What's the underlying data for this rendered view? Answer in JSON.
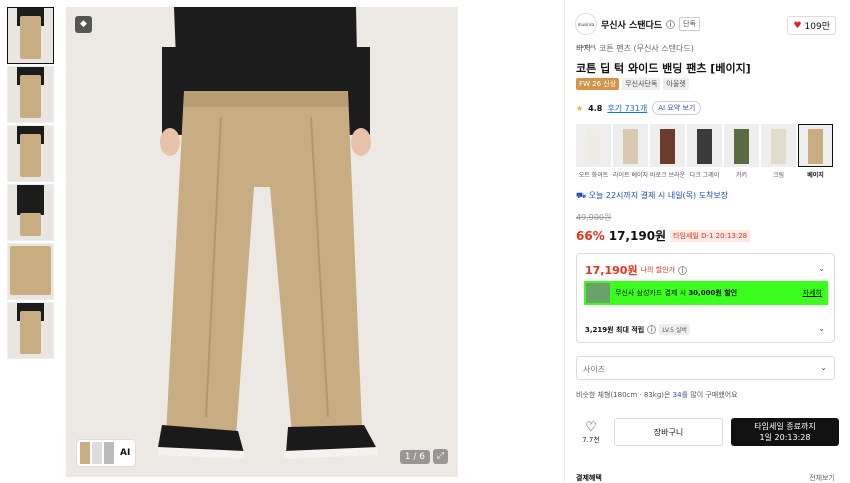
{
  "brand": {
    "logo_text": "musinsa standard",
    "name": "무신사 스탠다드",
    "badge": "단독"
  },
  "likes": "109만",
  "breadcrumb": [
    "바지",
    "코튼 팬츠 (무신사 스탠다드)"
  ],
  "product_title": "코튼 딥 턱 와이드 밴딩 팬츠 [베이지]",
  "tags": [
    "FW 26 신상",
    "무신사단독",
    "아울렛"
  ],
  "rating": {
    "score": "4.8",
    "reviews": "후기 731개",
    "ai_summary": "AI 요약 보기"
  },
  "swatches": [
    {
      "label": "오트 화이트",
      "color": "#efece6"
    },
    {
      "label": "라이트 베이지",
      "color": "#d7cab0"
    },
    {
      "label": "바로크 브라운",
      "color": "#6b3b2c"
    },
    {
      "label": "다크 그레이",
      "color": "#3a3a3a"
    },
    {
      "label": "카키",
      "color": "#5b6b3f"
    },
    {
      "label": "크림",
      "color": "#e3dccb"
    },
    {
      "label": "베이지",
      "color": "#c8ad83"
    }
  ],
  "delivery": "오늘 22시까지 결제 시 내일(목) 도착보장",
  "price": {
    "original": "49,900원",
    "discount": "66%",
    "current": "17,190원",
    "timesale": "타임세일 D-1 20:13:28"
  },
  "my_price": {
    "value": "17,190원",
    "label": "나의 할인가"
  },
  "card_promo": {
    "text_prefix": "무신사 삼성카드 결제 시 ",
    "text_bold": "30,000원 할인",
    "more": "자세히"
  },
  "points": {
    "value": "3,219원 최대 적립",
    "level": "LV.5 실버"
  },
  "size_select": {
    "placeholder": "사이즈"
  },
  "similar_fit": {
    "prefix": "비슷한 체형(180cm · 83kg)은 ",
    "num": "34",
    "suffix": "를 많이 구매했어요"
  },
  "wish_count": "7.7천",
  "cart_label": "장바구니",
  "buy": {
    "line1": "타임세일 종료까지",
    "line2": "1일 20:13:28"
  },
  "payment": {
    "label": "결제혜택",
    "all": "전체보기"
  },
  "hero": {
    "counter": "1 / 6",
    "ai_label": "AI"
  },
  "colors": {
    "accent_red": "#e8311a",
    "card_green": "#3cff20",
    "pants": "#c8ad83"
  }
}
